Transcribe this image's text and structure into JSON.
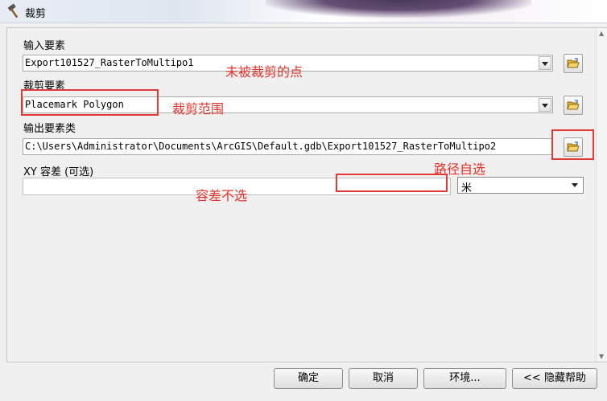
{
  "window": {
    "title": "裁剪"
  },
  "fields": {
    "input_label": "输入要素",
    "input_value": "Export101527_RasterToMultipo1",
    "clip_label": "裁剪要素",
    "clip_value": "Placemark Polygon",
    "output_label": "输出要素类",
    "output_value": "C:\\Users\\Administrator\\Documents\\ArcGIS\\Default.gdb\\Export101527_RasterToMultipo2",
    "xy_label": "XY 容差 (可选)",
    "xy_value": "",
    "unit_value": "米"
  },
  "annotations": {
    "input_note": "未被裁剪的点",
    "clip_note": "裁剪范围",
    "output_note": "路径自选",
    "xy_note": "容差不选",
    "color": "#e8312a"
  },
  "buttons": {
    "ok": "确定",
    "cancel": "取消",
    "env": "环境...",
    "hide_help": "<< 隐藏帮助"
  },
  "icons": {
    "title": "hammer-icon",
    "browse": "open-folder-icon"
  }
}
